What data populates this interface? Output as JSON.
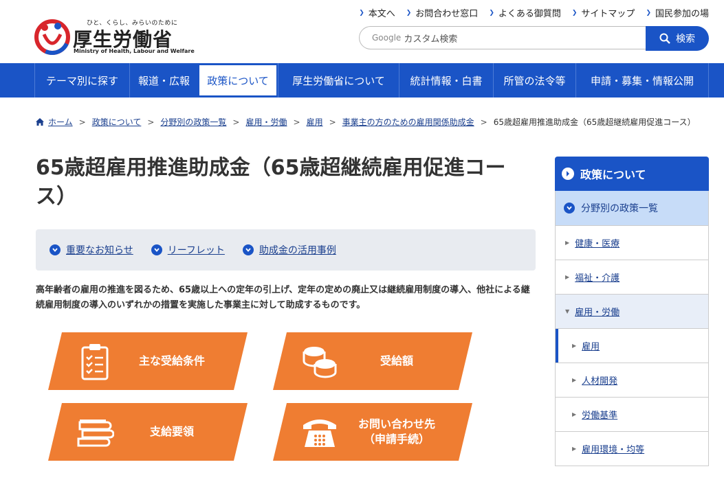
{
  "header": {
    "logo_tagline": "ひと、くらし、みらいのために",
    "logo_name": "厚生労働省",
    "logo_en": "Ministry of Health, Labour and Welfare",
    "util_links": [
      "本文へ",
      "お問合わせ窓口",
      "よくある御質問",
      "サイトマップ",
      "国民参加の場"
    ],
    "search_placeholder": "カスタム検索",
    "search_brand": "Google",
    "search_button": "検索"
  },
  "gnav": [
    {
      "label": "テーマ別に探す",
      "active": false
    },
    {
      "label": "報道・広報",
      "active": false
    },
    {
      "label": "政策について",
      "active": true
    },
    {
      "label": "厚生労働省について",
      "active": false
    },
    {
      "label": "統計情報・白書",
      "active": false
    },
    {
      "label": "所管の法令等",
      "active": false
    },
    {
      "label": "申請・募集・情報公開",
      "active": false
    }
  ],
  "breadcrumb": {
    "links": [
      "ホーム",
      "政策について",
      "分野別の政策一覧",
      "雇用・労働",
      "雇用",
      "事業主の方のための雇用関係助成金"
    ],
    "current": "65歳超雇用推進助成金（65歳超継続雇用促進コース）"
  },
  "page": {
    "title": "65歳超雇用推進助成金（65歳超継続雇用促進コース）",
    "anchors": [
      "重要なお知らせ",
      "リーフレット",
      "助成金の活用事例"
    ],
    "intro": "高年齢者の雇用の推進を図るため、65歳以上への定年の引上げ、定年の定めの廃止又は継続雇用制度の導入、他社による継続雇用制度の導入のいずれかの措置を実施した事業主に対して助成するものです。"
  },
  "tiles": [
    {
      "label": "主な受給条件",
      "icon": "clipboard-checklist-icon"
    },
    {
      "label": "受給額",
      "icon": "coins-icon"
    },
    {
      "label": "支給要領",
      "icon": "books-icon"
    },
    {
      "label": "お問い合わせ先\n（申請手続）",
      "icon": "telephone-icon"
    }
  ],
  "colors": {
    "brand_blue": "#1a54c6",
    "tile_orange": "#ef7d32"
  },
  "sidebar": {
    "heading": "政策について",
    "sub_heading": "分野別の政策一覧",
    "items": [
      {
        "label": "健康・医療",
        "level": 1
      },
      {
        "label": "福祉・介護",
        "level": 1
      },
      {
        "label": "雇用・労働",
        "level": 1,
        "open": true
      },
      {
        "label": "雇用",
        "level": 2,
        "current": true
      },
      {
        "label": "人材開発",
        "level": 2
      },
      {
        "label": "労働基準",
        "level": 2
      },
      {
        "label": "雇用環境・均等",
        "level": 2
      }
    ]
  }
}
